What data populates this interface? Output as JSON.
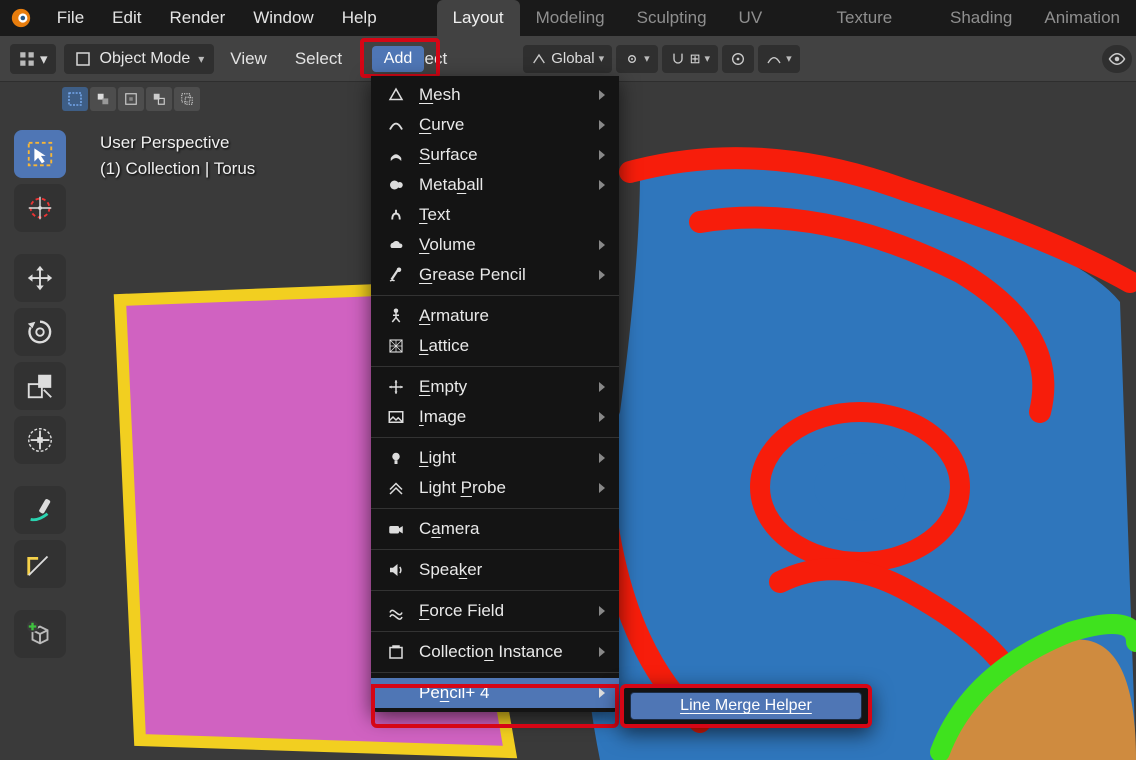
{
  "menubar": {
    "items": [
      "File",
      "Edit",
      "Render",
      "Window",
      "Help"
    ]
  },
  "tabs": {
    "items": [
      "Layout",
      "Modeling",
      "Sculpting",
      "UV Editing",
      "Texture Paint",
      "Shading",
      "Animation"
    ],
    "active": 0
  },
  "toolbar": {
    "mode_label": "Object Mode",
    "text_buttons": [
      "View",
      "Select",
      "Add",
      "Object"
    ],
    "orientation_label": "Global"
  },
  "viewport_overlay": {
    "line1": "User Perspective",
    "line2": "(1) Collection | Torus"
  },
  "add_menu": {
    "groups": [
      [
        {
          "label": "Mesh",
          "underline": "M",
          "sub": true,
          "icon": "mesh"
        },
        {
          "label": "Curve",
          "underline": "C",
          "sub": true,
          "icon": "curve"
        },
        {
          "label": "Surface",
          "underline": "S",
          "sub": true,
          "icon": "surface"
        },
        {
          "label": "Metaball",
          "underline": "b",
          "sub": true,
          "icon": "meta"
        },
        {
          "label": "Text",
          "underline": "T",
          "sub": false,
          "icon": "text"
        },
        {
          "label": "Volume",
          "underline": "V",
          "sub": true,
          "icon": "volume"
        },
        {
          "label": "Grease Pencil",
          "underline": "G",
          "sub": true,
          "icon": "gp"
        }
      ],
      [
        {
          "label": "Armature",
          "underline": "A",
          "sub": false,
          "icon": "armature"
        },
        {
          "label": "Lattice",
          "underline": "L",
          "sub": false,
          "icon": "lattice"
        }
      ],
      [
        {
          "label": "Empty",
          "underline": "E",
          "sub": true,
          "icon": "empty"
        },
        {
          "label": "Image",
          "underline": "I",
          "sub": true,
          "icon": "image"
        }
      ],
      [
        {
          "label": "Light",
          "underline": "L",
          "sub": true,
          "icon": "light"
        },
        {
          "label": "Light Probe",
          "underline": "P",
          "sub": true,
          "icon": "probe"
        }
      ],
      [
        {
          "label": "Camera",
          "underline": "a",
          "sub": false,
          "icon": "camera"
        }
      ],
      [
        {
          "label": "Speaker",
          "underline": "k",
          "sub": false,
          "icon": "speaker"
        }
      ],
      [
        {
          "label": "Force Field",
          "underline": "F",
          "sub": true,
          "icon": "force"
        }
      ],
      [
        {
          "label": "Collection Instance",
          "underline": "n",
          "sub": true,
          "icon": "collection"
        }
      ],
      [
        {
          "label": "Pencil+ 4",
          "underline": "n",
          "sub": true,
          "icon": "none",
          "highlight": true
        }
      ]
    ]
  },
  "submenu": {
    "label": "Line Merge Helper",
    "underline": "L"
  },
  "colors": {
    "accent": "#4f76b5",
    "red_hl": "#d60615",
    "menu_bg": "#141414",
    "panel": "#424242"
  }
}
